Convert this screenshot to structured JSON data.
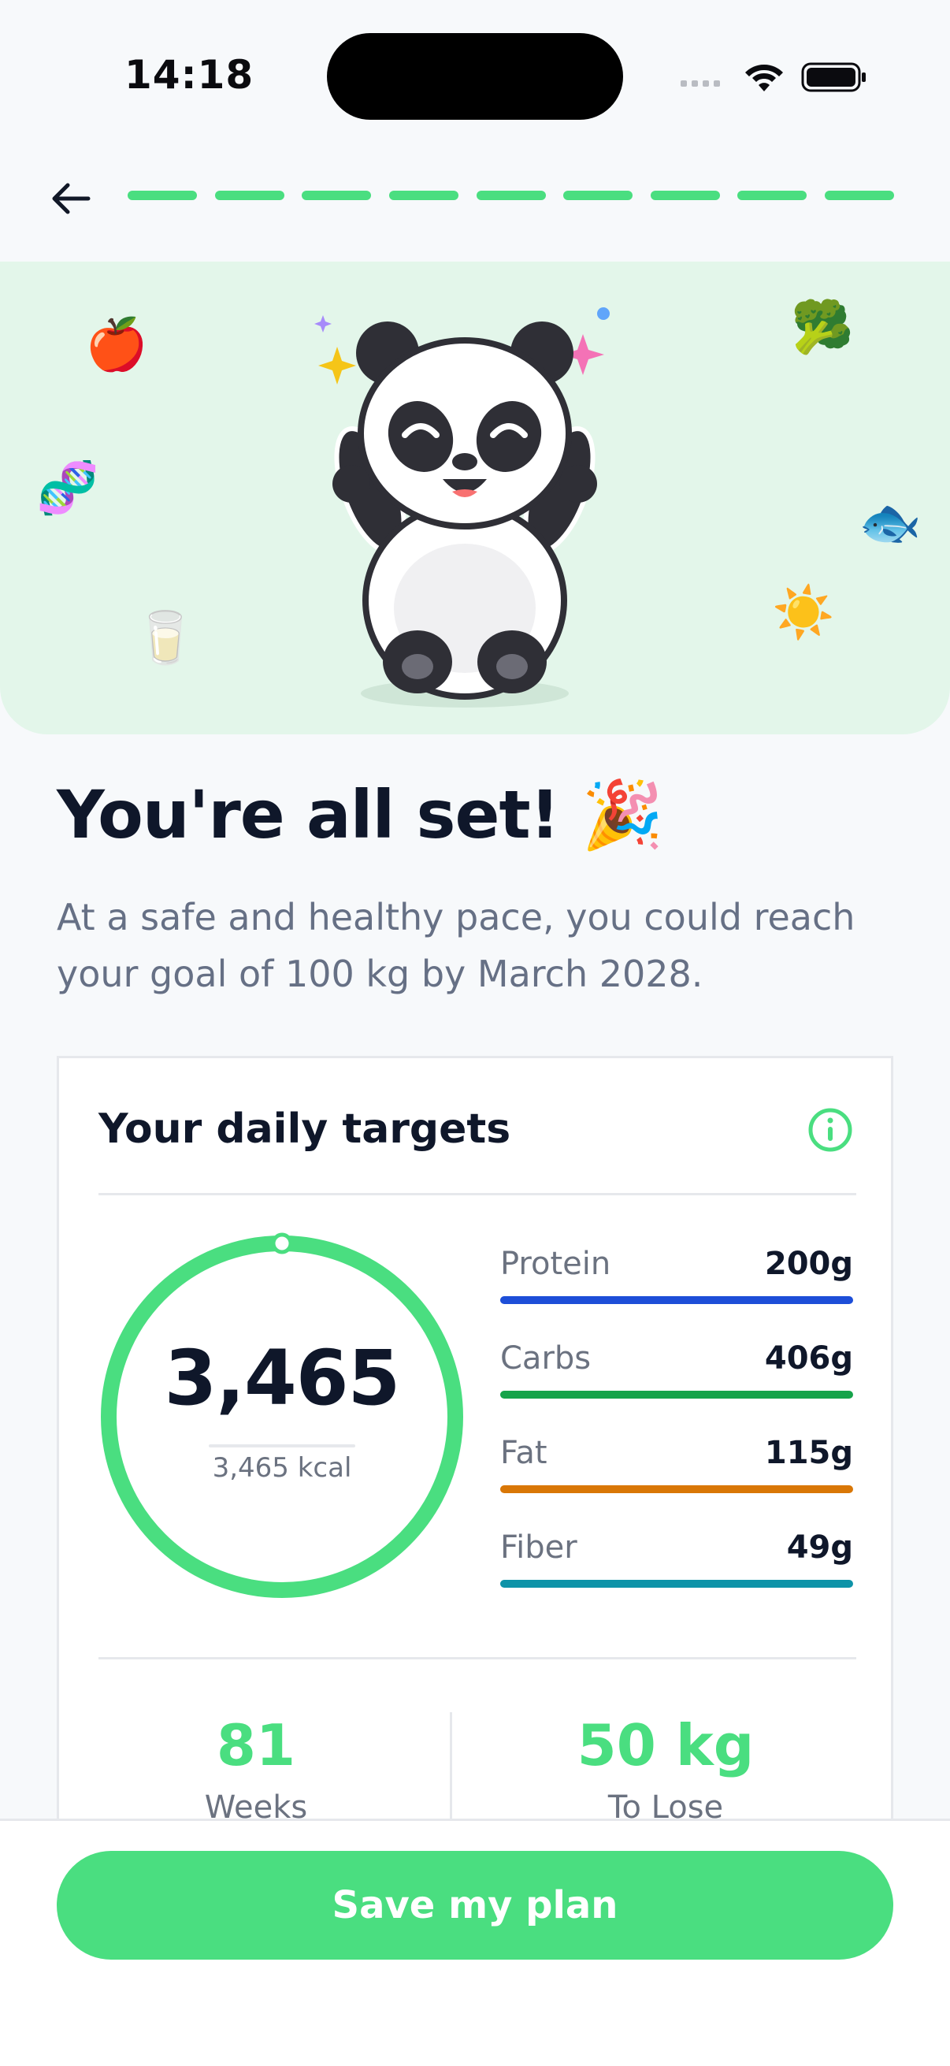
{
  "status_bar": {
    "time": "14:18"
  },
  "progress": {
    "total_steps": 9,
    "completed_steps": 9
  },
  "hero": {
    "emojis": [
      {
        "name": "apple-emoji",
        "glyph": "🍎"
      },
      {
        "name": "dna-emoji",
        "glyph": "🧬"
      },
      {
        "name": "milk-emoji",
        "glyph": "🥛"
      },
      {
        "name": "broccoli-emoji",
        "glyph": "🥦"
      },
      {
        "name": "fish-emoji",
        "glyph": "🐟"
      },
      {
        "name": "sun-emoji",
        "glyph": "☀️"
      }
    ]
  },
  "header": {
    "title": "You're all set!",
    "title_emoji": "🎉",
    "subtitle": "At a safe and healthy pace, you could reach your goal of 100 kg by March 2028."
  },
  "targets": {
    "title": "Your daily targets",
    "calories_big": "3,465",
    "calories_small": "3,465 kcal",
    "macros": [
      {
        "name": "Protein",
        "value": "200g",
        "color": "#1d4ed8"
      },
      {
        "name": "Carbs",
        "value": "406g",
        "color": "#16a34a"
      },
      {
        "name": "Fat",
        "value": "115g",
        "color": "#d97706"
      },
      {
        "name": "Fiber",
        "value": "49g",
        "color": "#0e93a8"
      }
    ],
    "stats": [
      {
        "number": "81",
        "label": "Weeks"
      },
      {
        "number": "50 kg",
        "label": "To Lose"
      }
    ]
  },
  "footer": {
    "save_label": "Save my plan"
  },
  "colors": {
    "accent": "#4ade80",
    "hero_bg": "#e3f6ea",
    "text_dark": "#0f172a",
    "text_muted": "#667085"
  }
}
